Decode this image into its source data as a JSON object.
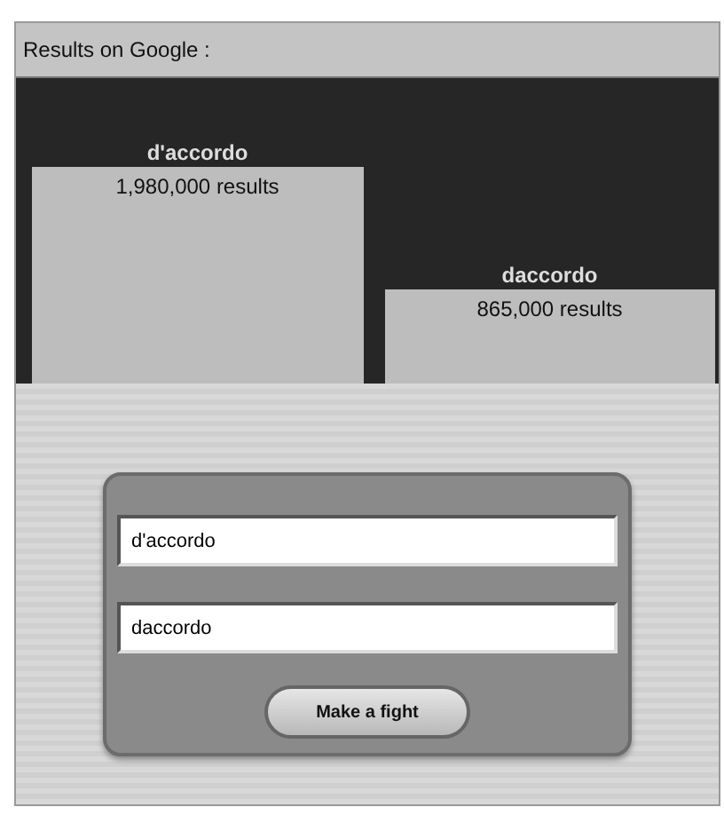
{
  "header": {
    "title": "Results on Google :"
  },
  "results": [
    {
      "term": "d'accordo",
      "count": "1,980,000 results"
    },
    {
      "term": "daccordo",
      "count": "865,000 results"
    }
  ],
  "form": {
    "fields": [
      {
        "value": "d'accordo"
      },
      {
        "value": "daccordo"
      }
    ],
    "button": "Make a fight"
  }
}
